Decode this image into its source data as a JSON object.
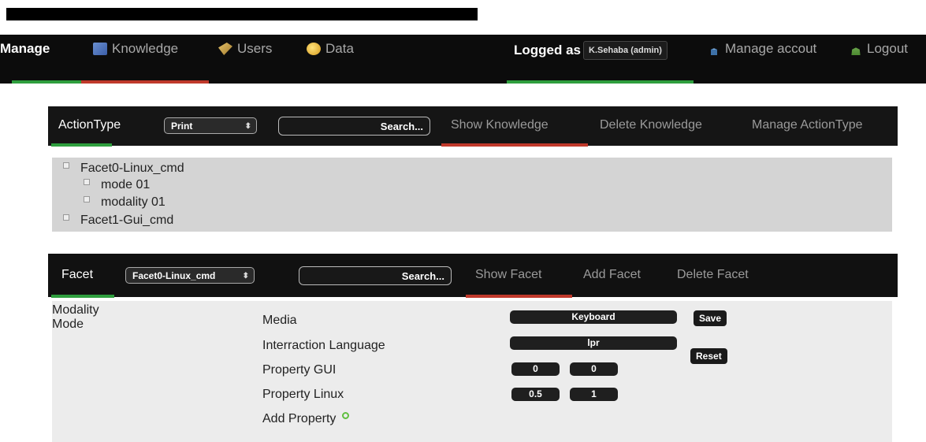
{
  "topnav": {
    "manage": "Manage",
    "knowledge": "Knowledge",
    "users": "Users",
    "data": "Data",
    "logged_as": "Logged as",
    "user": "K.Sehaba (admin)",
    "manage_account": "Manage accout",
    "logout": "Logout",
    "icons": {
      "knowledge": "book-icon",
      "users": "users-icon",
      "data": "database-icon",
      "account": "person-icon",
      "logout": "logout-icon"
    }
  },
  "actiontype_panel": {
    "title": "ActionType",
    "select_value": "Print",
    "search_placeholder": "Search...",
    "tabs": [
      "Show Knowledge",
      "Delete Knowledge",
      "Manage ActionType"
    ]
  },
  "tree": [
    {
      "label": "Facet0-Linux_cmd",
      "level": 0
    },
    {
      "label": "mode 01",
      "level": 1
    },
    {
      "label": "modality 01",
      "level": 1
    },
    {
      "label": "Facet1-Gui_cmd",
      "level": 0
    }
  ],
  "facet_panel": {
    "title": "Facet",
    "select_value": "Facet0-Linux_cmd",
    "search_placeholder": "Search...",
    "tabs": [
      "Show Facet",
      "Add Facet",
      "Delete Facet"
    ]
  },
  "facet_form": {
    "left_list": [
      "Modality",
      "Mode"
    ],
    "media_label": "Media",
    "media_value": "Keyboard",
    "language_label": "Interraction Language",
    "language_value": "lpr",
    "gui_label": "Property GUI",
    "gui_values": [
      "0",
      "0"
    ],
    "linux_label": "Property Linux",
    "linux_values": [
      "0.5",
      "1"
    ],
    "add_property": "Add Property",
    "save": "Save",
    "reset": "Reset"
  },
  "colors": {
    "accent_red": "#c0392b",
    "accent_green": "#2e9e3e",
    "bar": "#111111"
  }
}
